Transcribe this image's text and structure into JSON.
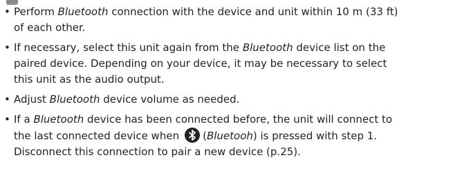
{
  "bullet_char": "•",
  "items": [
    {
      "line1_a": "Perform ",
      "line1_b": "Bluetooth",
      "line1_c": " connection with the device and unit within 10 m (33 ft)",
      "line2": "of each other."
    },
    {
      "line1_a": "If necessary, select this unit again from the ",
      "line1_b": "Bluetooth",
      "line1_c": " device list on the",
      "line2": "paired device. Depending on your device, it may be necessary to select",
      "line3": "this unit as the audio output."
    },
    {
      "line1_a": "Adjust ",
      "line1_b": "Bluetooth",
      "line1_c": " device volume as needed."
    },
    {
      "line1_a": "If a ",
      "line1_b": "Bluetooth",
      "line1_c": " device has been connected before, the unit will connect to",
      "line2_a": "the last connected device when",
      "line2_b": "(",
      "line2_c": "Bluetooh",
      "line2_d": ") is pressed with step 1.",
      "line3": "Disconnect this connection to pair a new device (p.25)."
    }
  ],
  "icons": {
    "bluetooth": "bluetooth-icon"
  }
}
